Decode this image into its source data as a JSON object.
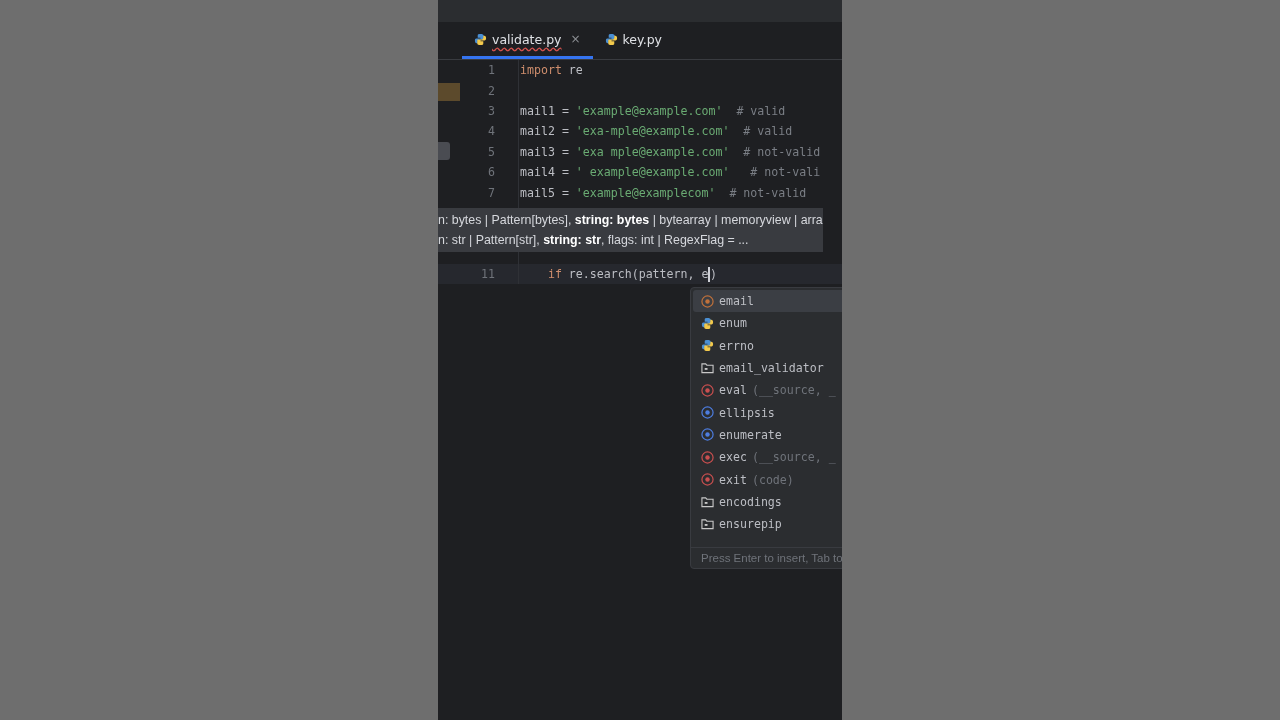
{
  "tabs": [
    {
      "label": "validate.py",
      "selected": true,
      "has_error": true,
      "close": "×"
    },
    {
      "label": "key.py",
      "selected": false,
      "has_error": false
    }
  ],
  "lines": [
    {
      "number": "1",
      "segments": [
        {
          "kind": "keyword",
          "text": "import"
        },
        {
          "kind": "plain",
          "text": " re"
        }
      ]
    },
    {
      "number": "2"
    },
    {
      "number": "3",
      "segments": [
        {
          "kind": "plain",
          "text": "mail1 = "
        },
        {
          "kind": "string",
          "text": "'example@example.com'"
        },
        {
          "kind": "comment",
          "text": "  # valid"
        }
      ]
    },
    {
      "number": "4",
      "segments": [
        {
          "kind": "plain",
          "text": "mail2 = "
        },
        {
          "kind": "string",
          "text": "'exa-mple@example.com'"
        },
        {
          "kind": "comment",
          "text": "  # valid"
        }
      ]
    },
    {
      "number": "5",
      "segments": [
        {
          "kind": "plain",
          "text": "mail3 = "
        },
        {
          "kind": "string",
          "text": "'exa mple@example.com'"
        },
        {
          "kind": "comment",
          "text": "  # not-valid"
        }
      ]
    },
    {
      "number": "6",
      "segments": [
        {
          "kind": "plain",
          "text": "mail4 = "
        },
        {
          "kind": "string",
          "text": "' example@example.com'"
        },
        {
          "kind": "comment",
          "text": "   # not-vali"
        }
      ]
    },
    {
      "number": "7",
      "segments": [
        {
          "kind": "plain",
          "text": "mail5 = "
        },
        {
          "kind": "string",
          "text": "'example@examplecom'"
        },
        {
          "kind": "comment",
          "text": "  # not-valid"
        }
      ]
    },
    {
      "number": "11",
      "segments": [
        {
          "kind": "indent"
        },
        {
          "kind": "keyword",
          "text": "if"
        },
        {
          "kind": "plain",
          "text": " re.search(pattern, e"
        },
        {
          "kind": "caret"
        },
        {
          "kind": "plain",
          "text": ")"
        }
      ]
    }
  ],
  "tooltip": [
    "n: bytes | Pattern[bytes], **string: bytes** | bytearray | memoryview | arra",
    "n: str | Pattern[str], **string: str**, flags: int | RegexFlag = ..."
  ],
  "completion": {
    "items": [
      {
        "kind": "parameter",
        "name": "email",
        "selected": true
      },
      {
        "kind": "module",
        "name": "enum",
        "selected": false
      },
      {
        "kind": "module",
        "name": "errno",
        "selected": false
      },
      {
        "kind": "package",
        "name": "email_validator",
        "selected": false
      },
      {
        "kind": "function",
        "name": "eval",
        "signature": "(__source, _",
        "selected": false
      },
      {
        "kind": "class",
        "name": "ellipsis",
        "selected": false
      },
      {
        "kind": "class",
        "name": "enumerate",
        "selected": false
      },
      {
        "kind": "function",
        "name": "exec",
        "signature": "(__source, _",
        "selected": false
      },
      {
        "kind": "function",
        "name": "exit",
        "signature": "(code)",
        "selected": false
      },
      {
        "kind": "package",
        "name": "encodings",
        "selected": false
      },
      {
        "kind": "package",
        "name": "ensurepip",
        "selected": false
      }
    ],
    "hint": "Press Enter to insert, Tab to"
  }
}
